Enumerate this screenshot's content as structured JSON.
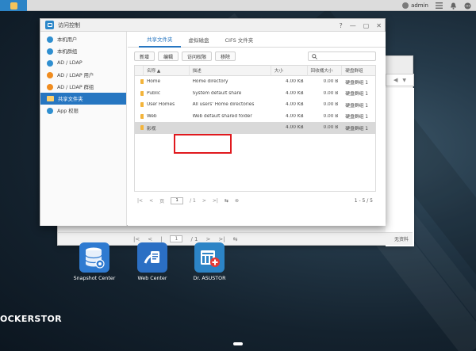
{
  "topbar": {
    "user": "admin",
    "icons": [
      "app-icon",
      "user-icon",
      "menu-icon",
      "notification-icon",
      "options-icon"
    ]
  },
  "window": {
    "title": "访问控制",
    "controls": [
      "help-icon",
      "minimize-icon",
      "maximize-icon",
      "close-icon"
    ]
  },
  "sidebar": {
    "items": [
      {
        "label": "本机用户",
        "icon": "user-icon"
      },
      {
        "label": "本机群组",
        "icon": "group-icon"
      },
      {
        "label": "AD / LDAP",
        "icon": "ad-ldap-icon"
      },
      {
        "label": "AD / LDAP 用户",
        "icon": "ad-user-icon"
      },
      {
        "label": "AD / LDAP 群组",
        "icon": "ad-group-icon"
      },
      {
        "label": "共享文件夹",
        "icon": "shared-folder-icon",
        "active": true
      },
      {
        "label": "App 权限",
        "icon": "app-permission-icon"
      }
    ]
  },
  "tabs": [
    {
      "label": "共享文件夹",
      "active": true
    },
    {
      "label": "虚拟磁盘"
    },
    {
      "label": "CIFS 文件夹"
    }
  ],
  "toolbar": {
    "buttons": [
      "新增",
      "编辑",
      "访问权限",
      "移除"
    ],
    "search_placeholder": ""
  },
  "table": {
    "headers": [
      "名称 ▲",
      "描述",
      "大小",
      "回收桶大小",
      "硬盘群组"
    ],
    "rows": [
      {
        "name": "Home",
        "desc": "Home directory",
        "size": "4.00 KB",
        "recycle": "0.00 B",
        "volume": "硬盘群组 1"
      },
      {
        "name": "Public",
        "desc": "System default share",
        "size": "4.00 KB",
        "recycle": "0.00 B",
        "volume": "硬盘群组 1"
      },
      {
        "name": "User Homes",
        "desc": "All users' Home directories",
        "size": "4.00 KB",
        "recycle": "0.00 B",
        "volume": "硬盘群组 1"
      },
      {
        "name": "Web",
        "desc": "Web default shared folder",
        "size": "4.00 KB",
        "recycle": "0.00 B",
        "volume": "硬盘群组 1"
      },
      {
        "name": "影视",
        "desc": "",
        "size": "4.00 KB",
        "recycle": "0.00 B",
        "volume": "硬盘群组 1",
        "selected": true
      }
    ]
  },
  "pager": {
    "page_prefix": "页",
    "page_value": "1",
    "page_total": "/ 1",
    "count": "1 - 5 / 5"
  },
  "bg_window": {
    "page_value": "1",
    "page_total": "/ 1",
    "right_text": "无资料"
  },
  "desktop": {
    "icons": [
      {
        "label": "Snapshot Center",
        "color": "#2f7bd1"
      },
      {
        "label": "Web Center",
        "color": "#2b6fc4"
      },
      {
        "label": "Dr. ASUSTOR",
        "color": "#2c84c6"
      }
    ],
    "brand": "OCKERSTOR"
  },
  "colors": {
    "accent": "#2676c1",
    "highlight": "#e0191e",
    "folder": "#f3b43b"
  }
}
